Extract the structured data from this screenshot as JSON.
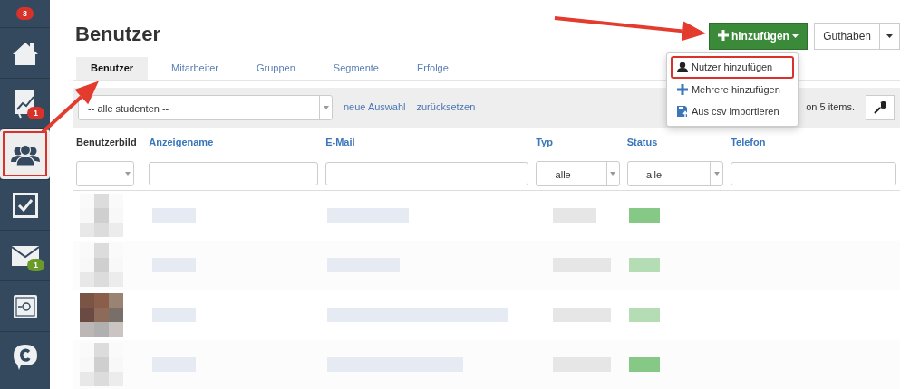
{
  "sidebar": {
    "top_badge": "3",
    "items": [
      {
        "kind": "home",
        "selected": false,
        "highlighted": false
      },
      {
        "kind": "chart",
        "selected": false,
        "highlighted": false,
        "badge": {
          "text": "1",
          "color": "#d9322b"
        }
      },
      {
        "kind": "users",
        "selected": true,
        "highlighted": true
      },
      {
        "kind": "check",
        "selected": false,
        "highlighted": false
      },
      {
        "kind": "mail",
        "selected": false,
        "highlighted": false,
        "badge": {
          "text": "1",
          "color": "#6a9a2a"
        }
      },
      {
        "kind": "safe",
        "selected": false,
        "highlighted": false
      },
      {
        "kind": "chat",
        "selected": false,
        "highlighted": false
      }
    ]
  },
  "page_title": "Benutzer",
  "add_button": {
    "label": "hinzufügen",
    "arrow": true,
    "expanded": true
  },
  "credit_button": {
    "label": "Guthaben"
  },
  "add_menu": [
    {
      "kind": "person",
      "label": "Nutzer hinzufügen",
      "highlighted": true
    },
    {
      "kind": "plus",
      "label": "Mehrere hinzufügen",
      "highlighted": false
    },
    {
      "kind": "import",
      "label": "Aus csv importieren",
      "highlighted": false
    }
  ],
  "tabs": [
    {
      "label": "Benutzer",
      "selected": true,
      "arrow": true
    },
    {
      "label": "Mitarbeiter",
      "selected": false,
      "arrow": false
    },
    {
      "label": "Gruppen",
      "selected": false,
      "arrow": false
    },
    {
      "label": "Segmente",
      "selected": false,
      "arrow": false
    },
    {
      "label": "Erfolge",
      "selected": false,
      "arrow": false
    }
  ],
  "toolbar": {
    "selection": "-- alle studenten --",
    "links": [
      "neue Auswahl",
      "zurücksetzen"
    ],
    "summary": "on 5 items."
  },
  "table": {
    "columns": [
      {
        "label": "Benutzerbild",
        "sortable": false,
        "filter": {
          "kind": "select",
          "value": "--"
        }
      },
      {
        "label": "Anzeigename",
        "sortable": true,
        "filter": {
          "kind": "text"
        }
      },
      {
        "label": "E-Mail",
        "sortable": true,
        "filter": {
          "kind": "text"
        }
      },
      {
        "label": "Typ",
        "sortable": true,
        "filter": {
          "kind": "select",
          "value": "-- alle --"
        }
      },
      {
        "label": "Status",
        "sortable": true,
        "filter": {
          "kind": "select",
          "value": "-- alle --"
        }
      },
      {
        "label": "Telefon",
        "sortable": true,
        "filter": {
          "kind": "text"
        }
      }
    ],
    "rows": [
      {
        "kind": "blurred",
        "has_photo": false
      },
      {
        "kind": "blurred",
        "has_photo": false
      },
      {
        "kind": "blurred",
        "has_photo": true
      },
      {
        "kind": "blurred",
        "has_photo": false
      }
    ]
  }
}
